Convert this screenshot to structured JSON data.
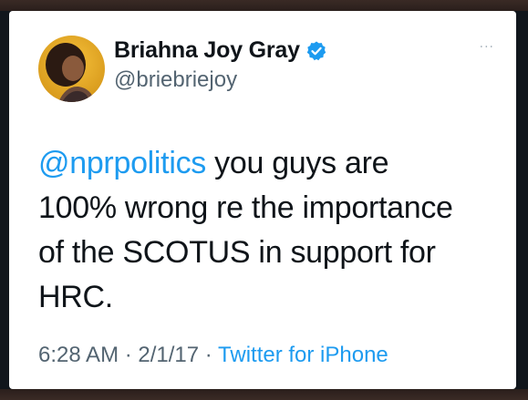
{
  "tweet": {
    "author_name": "Briahna Joy Gray",
    "author_handle": "@briebriejoy",
    "more_label": "...",
    "mention": "@nprpolitics",
    "text_line1": " you guys are",
    "text_line2": "100% wrong re the importance",
    "text_line3": "of the SCOTUS in support for",
    "text_line4": "HRC.",
    "time": "6:28 AM",
    "separator": " · ",
    "date": "2/1/17",
    "source": "Twitter for iPhone"
  },
  "icons": {
    "verified": "verified-badge-icon",
    "avatar": "profile-avatar",
    "more": "more-options-icon"
  },
  "colors": {
    "link": "#1d9bf0",
    "verified": "#1d9bf0",
    "text": "#0f1419",
    "secondary": "#536471"
  }
}
